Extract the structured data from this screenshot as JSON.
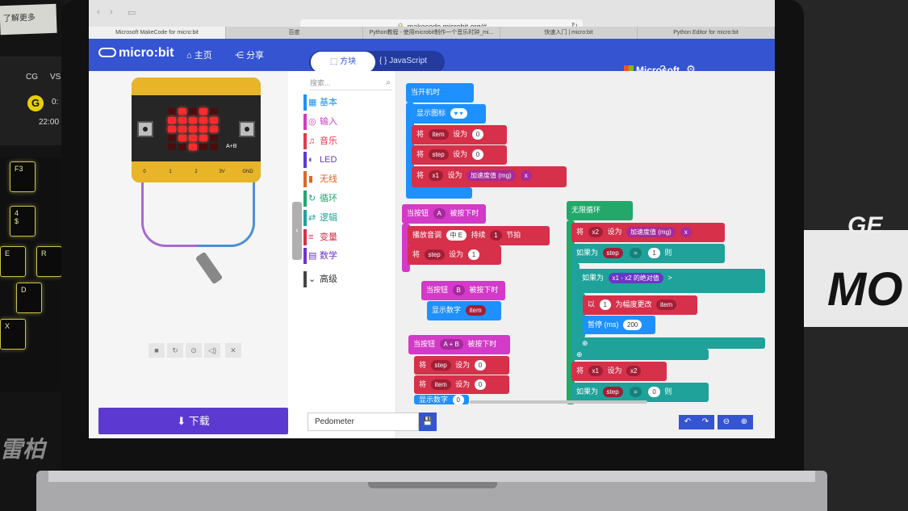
{
  "photo": {
    "note_card": "了解更多",
    "cg_label": "CG",
    "vs_label": "VS",
    "cg_logo": "G",
    "score": "0:",
    "time": "22:00",
    "keys": [
      "F3",
      "4\n$",
      "E",
      "R",
      "D",
      "X"
    ],
    "brand_left": "雷柏",
    "box_text_top": "GE",
    "box_text_main": "MO"
  },
  "browser": {
    "address": "makecode.microbit.org/#",
    "tabs": [
      "Microsoft MakeCode for micro:bit",
      "百度",
      "Python教程 - 使用microbit制作一个音乐时钟_mi...",
      "快速入门 | micro:bit",
      "Python Editor for micro:bit"
    ]
  },
  "app": {
    "logo": "micro:bit",
    "home_label": "主页",
    "share_label": "分享",
    "blocks_tab": "方块",
    "js_tab": "{ } JavaScript",
    "microsoft_label": "Microsoft",
    "help_icon": "question-icon",
    "settings_icon": "gear-icon"
  },
  "simulator": {
    "led_rows": [
      [
        0,
        1,
        0,
        1,
        0
      ],
      [
        1,
        1,
        1,
        1,
        1
      ],
      [
        1,
        1,
        1,
        1,
        1
      ],
      [
        0,
        1,
        1,
        1,
        0
      ],
      [
        0,
        0,
        1,
        0,
        0
      ]
    ],
    "pins": [
      "0",
      "1",
      "2",
      "3V",
      "GND"
    ],
    "ab_label": "A+B",
    "controls": [
      "■",
      "↻",
      "⊙",
      "◁)",
      "✕"
    ]
  },
  "toolbox": {
    "search_placeholder": "搜索...",
    "categories": [
      {
        "label": "基本",
        "color": "#1e90ff",
        "icon": "grid-icon"
      },
      {
        "label": "输入",
        "color": "#d33ac7",
        "icon": "target-icon"
      },
      {
        "label": "音乐",
        "color": "#e6374b",
        "icon": "headphones-icon"
      },
      {
        "label": "LED",
        "color": "#5c3ad1",
        "icon": "toggle-icon"
      },
      {
        "label": "无线",
        "color": "#e0662a",
        "icon": "signal-icon"
      },
      {
        "label": "循环",
        "color": "#20a86a",
        "icon": "refresh-icon"
      },
      {
        "label": "逻辑",
        "color": "#1ea29a",
        "icon": "shuffle-icon"
      },
      {
        "label": "变量",
        "color": "#d6304a",
        "icon": "list-icon"
      },
      {
        "label": "数学",
        "color": "#6b35c8",
        "icon": "calculator-icon"
      },
      {
        "label": "高级",
        "color": "#444444",
        "icon": "chevron-down-icon"
      }
    ]
  },
  "blocks": {
    "on_start": "当开机时",
    "show_icon": "显示图标",
    "set1_var": "item",
    "set_label": "设为",
    "set1_val": "0",
    "set2_var": "step",
    "set2_val": "0",
    "set3_var": "x1",
    "accel": "加速度值 (mg)",
    "axis": "x",
    "let_label": "将",
    "on_button_a": "当按钮",
    "btn_a": "A",
    "pressed": "被按下时",
    "play_tone": "播放音调",
    "tone": "中 E",
    "duration": "持续",
    "beat_count": "1",
    "beat": "节拍",
    "set_step": "step",
    "step_val": "1",
    "btn_b": "B",
    "show_number": "显示数字",
    "num_var": "item",
    "btn_ab": "A + B",
    "ab_step_val": "0",
    "ab_item_val": "0",
    "show_number2_val": "0",
    "forever": "无限循环",
    "set_x2": "x2",
    "if_label": "如果为",
    "then": "则",
    "eq": "=",
    "one": "1",
    "abs_label": "的绝对值",
    "minus": "-",
    "gt": ">",
    "change_by": "以",
    "change_val": "1",
    "change_text": "为幅度更改",
    "change_var": "item",
    "pause": "暂停 (ms)",
    "pause_val": "200",
    "set_x1_to": "x1",
    "set_x1_src": "x2",
    "if2_var": "step",
    "if2_val": "0"
  },
  "footer": {
    "download": "下载",
    "project_name": "Pedometer"
  }
}
